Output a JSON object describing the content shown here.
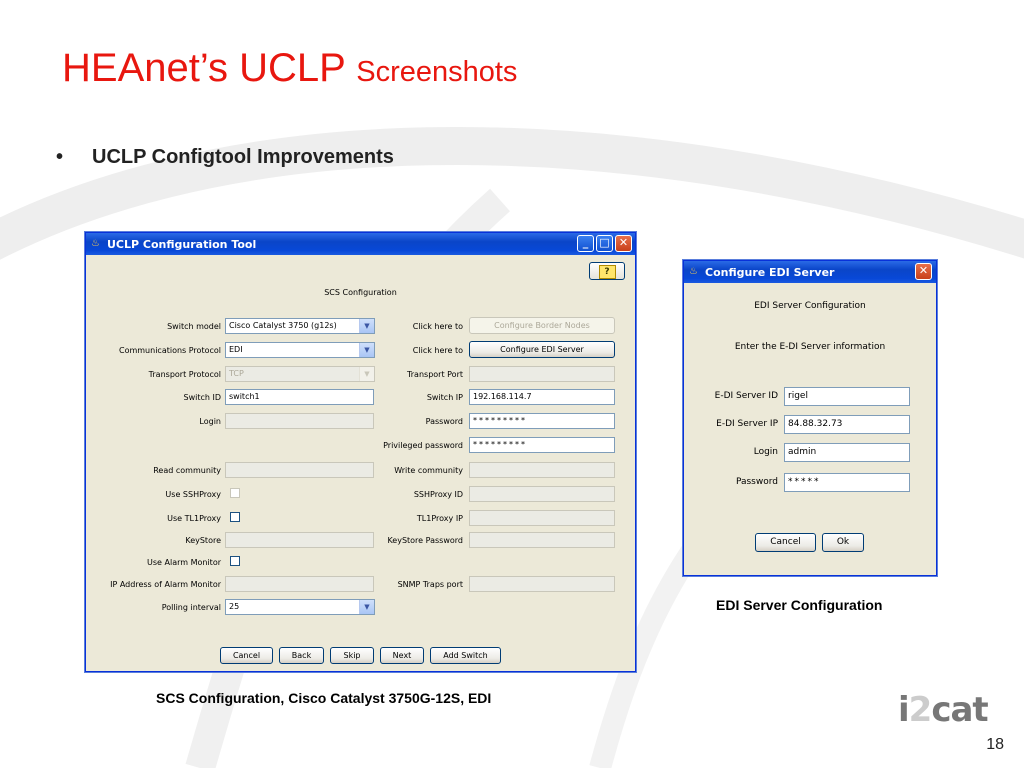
{
  "slide": {
    "title_main": "HEAnet’s UCLP",
    "title_sub": "Screenshots",
    "bullet": "UCLP Configtool Improvements",
    "bullet_symbol": "•",
    "caption_left": "SCS Configuration, Cisco Catalyst 3750G-12S,  EDI",
    "caption_right": "EDI Server Configuration",
    "logo_i": "i",
    "logo_2": "2",
    "logo_cat": "cat",
    "page_number": "18",
    "title_color": "#e8170f"
  },
  "uclp_window": {
    "title": "UCLP Configuration Tool",
    "help_icon": "?",
    "section_heading": "SCS Configuration",
    "switch_model_label": "Switch model",
    "switch_model_value": "Cisco Catalyst 3750 (g12s)",
    "comm_protocol_label": "Communications Protocol",
    "comm_protocol_value": "EDI",
    "transport_protocol_label": "Transport Protocol",
    "transport_protocol_value": "TCP",
    "switch_id_label": "Switch ID",
    "switch_id_value": "switch1",
    "login_label": "Login",
    "read_community_label": "Read community",
    "use_sshproxy_label": "Use SSHProxy",
    "use_tl1proxy_label": "Use TL1Proxy",
    "keystore_label": "KeyStore",
    "use_alarm_monitor_label": "Use Alarm Monitor",
    "alarm_ip_label": "IP Address of Alarm Monitor",
    "polling_interval_label": "Polling interval",
    "polling_interval_value": "25",
    "click_here_1": "Click here to",
    "border_nodes_button": "Configure Border Nodes",
    "click_here_2": "Click here to",
    "edi_server_button": "Configure EDI Server",
    "transport_port_label": "Transport Port",
    "switch_ip_label": "Switch IP",
    "switch_ip_value": "192.168.114.7",
    "password_label": "Password",
    "password_value": "*********",
    "priv_password_label": "Privileged password",
    "priv_password_value": "*********",
    "write_community_label": "Write community",
    "sshproxy_id_label": "SSHProxy ID",
    "tl1proxy_ip_label": "TL1Proxy IP",
    "keystore_password_label": "KeyStore Password",
    "snmp_traps_label": "SNMP Traps port",
    "buttons": {
      "cancel": "Cancel",
      "back": "Back",
      "skip": "Skip",
      "next": "Next",
      "add_switch": "Add Switch"
    }
  },
  "edi_dialog": {
    "title": "Configure EDI Server",
    "heading": "EDI Server Configuration",
    "instruction": "Enter the E-DI Server information",
    "server_id_label": "E-DI Server ID",
    "server_id_value": "rigel",
    "server_ip_label": "E-DI Server IP",
    "server_ip_value": "84.88.32.73",
    "login_label": "Login",
    "login_value": "admin",
    "password_label": "Password",
    "password_value": "*****",
    "cancel_button": "Cancel",
    "ok_button": "Ok"
  }
}
